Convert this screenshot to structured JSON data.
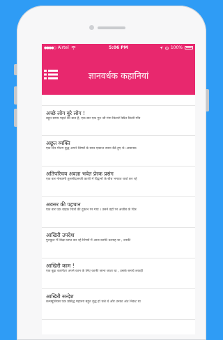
{
  "status_bar": {
    "carrier": "Airtel",
    "time": "5:06 PM",
    "battery": "100%"
  },
  "header": {
    "title": "ज्ञानवर्धक कहानियां",
    "menu_icon": "menu-icon"
  },
  "stories": [
    {
      "title": "अच्छे लोग बुरे लोग !",
      "snippet": "बहुत समय पहले की बात है, एक बार एक गुरु जी गंगा किनारे स्थित किसी गाँव"
    },
    {
      "title": "अछूत व्यक्ति",
      "snippet": "एक दिन गौतम बुद्ध अपने शिष्यों के साथ एकान्त स्थान बैठे हुए थे। अचानक"
    },
    {
      "title": "अतिपरिचय अवज्ञा भवेत प्रेरक प्रसंग",
      "snippet": "एक बार गोस्वामी तुलसीदासजी काशी में विद्वानों के बीच भगवत चर्चा कर रहे"
    },
    {
      "title": "अवसर की पहचान",
      "snippet": "एक बार एक ग्राहक चित्रों की दुकान पर गया । उसने वहाँ पर अजीब के चित्र"
    },
    {
      "title": "आखिरी उपदेश",
      "snippet": "गुरुकुल में शिक्षा प्राप्त कर रहे शिष्यों में आज काफी उत्साह था , उनकी"
    },
    {
      "title": "आखिरी काम !",
      "snippet": "एक बूढ़ा कारपेंटर अपने काम के लिए काफी जाना जाता था , उसके बनाये लकड़ी"
    },
    {
      "title": "आखिरी सन्देश",
      "snippet": "कन्फ्यूशियस एक प्रसिद्ध महात्मा बहुत वृद्ध हो चले थे और उनका अंत निकट था"
    }
  ],
  "colors": {
    "accent": "#e8286e",
    "background": "#2f9cf5"
  }
}
